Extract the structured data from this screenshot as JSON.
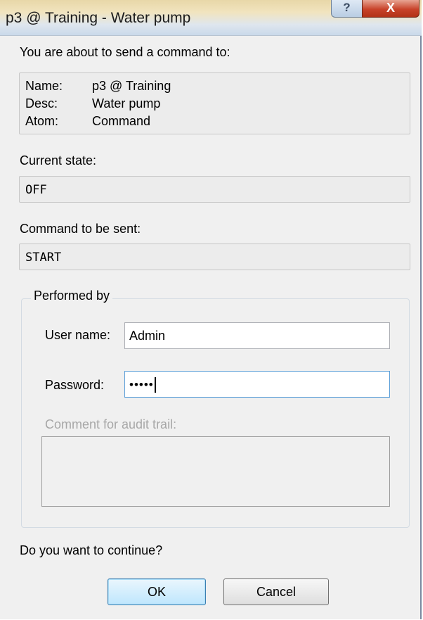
{
  "window": {
    "title": "p3 @ Training - Water pump",
    "help_glyph": "?",
    "close_glyph": "X"
  },
  "intro": "You are about to send a command to:",
  "target": {
    "name_label": "Name:",
    "name_value": "p3 @ Training",
    "desc_label": "Desc:",
    "desc_value": "Water pump",
    "atom_label": "Atom:",
    "atom_value": "Command"
  },
  "current_state": {
    "label": "Current state:",
    "value": "OFF"
  },
  "command": {
    "label": "Command to be sent:",
    "value": "START"
  },
  "performed_by": {
    "legend": "Performed by",
    "user_label": "User name:",
    "user_value": "Admin",
    "password_label": "Password:",
    "password_value": "•••••",
    "comment_label": "Comment for audit trail:",
    "comment_value": ""
  },
  "question": "Do you want to continue?",
  "buttons": {
    "ok": "OK",
    "cancel": "Cancel"
  }
}
